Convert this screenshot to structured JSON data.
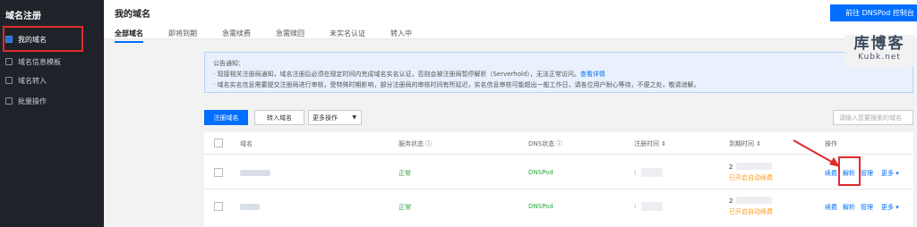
{
  "sidebar": {
    "title": "域名注册",
    "items": [
      {
        "label": "我的域名",
        "icon": "domain-icon"
      },
      {
        "label": "域名信息模板",
        "icon": "template-icon"
      },
      {
        "label": "域名转入",
        "icon": "transfer-icon"
      },
      {
        "label": "批量操作",
        "icon": "batch-icon"
      }
    ]
  },
  "header": {
    "title": "我的域名",
    "console_button": "前往 DNSPod 控制台",
    "tabs": [
      "全部域名",
      "即将到期",
      "急需续费",
      "急需赎回",
      "未实名认证",
      "转入中"
    ]
  },
  "watermark": {
    "title": "库博客",
    "subtitle": "Kubk.net"
  },
  "notice": {
    "title": "公告通知：",
    "line1": "· 现接相关注册局通知，域名注册后必须在规定时间内完成域名实名认证，否则会被注册局暂停解析（Serverhold），无法正常访问。",
    "line1_link": "查看详情",
    "line2": "· 域名实名信息需要提交注册局进行审核，受特殊时期影响，部分注册局的审核时间有所延迟，实名信息审核可能超出一般工作日，请各位用户耐心等待，不便之处，敬请谅解。"
  },
  "toolbar": {
    "register": "注册域名",
    "transfer_in": "转入域名",
    "more_ops": "更多操作",
    "search_placeholder": "请输入您要搜索的域名"
  },
  "table": {
    "headers": {
      "domain": "域名",
      "service_status": "服务状态 ⓘ",
      "dns_status": "DNS状态 ⓘ",
      "reg_time": "注册时间 ⇕",
      "expire_time": "到期时间 ⇕",
      "actions": "操作"
    },
    "rows": [
      {
        "status": "正常",
        "dns": "DNSPod",
        "reg_prefix": ":",
        "expire_prefix": "2",
        "auto_renew": "已开启自动续费",
        "renew": "续费",
        "resolve": "解析",
        "manage": "管理",
        "more": "更多 ▾"
      },
      {
        "status": "正常",
        "dns": "DNSPod",
        "reg_prefix": ":",
        "expire_prefix": "2",
        "auto_renew": "已开启自动续费",
        "renew": "续费",
        "resolve": "解析",
        "manage": "管理",
        "more": "更多 ▾"
      }
    ]
  },
  "colors": {
    "primary": "#006eff",
    "sidebar_bg": "#1f2329",
    "highlight": "#e02b2b",
    "ok": "#2da641",
    "warn": "#ff9b1f"
  }
}
